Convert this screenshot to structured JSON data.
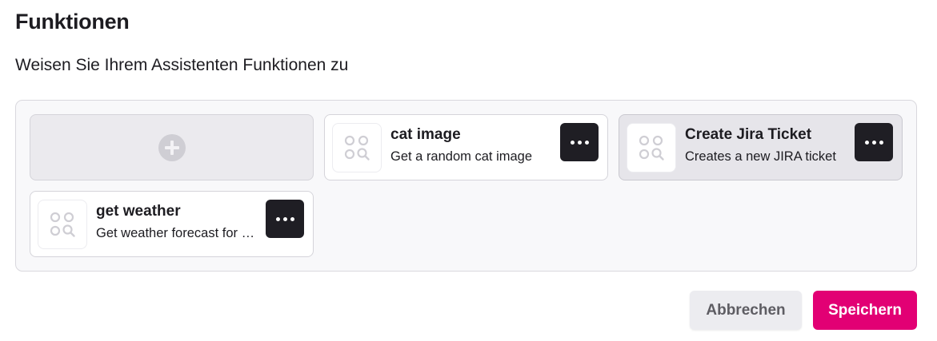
{
  "section": {
    "title": "Funktionen",
    "subtitle": "Weisen Sie Ihrem Assistenten Funktionen zu"
  },
  "add_tile": {
    "icon": "plus-circle-icon"
  },
  "functions": [
    {
      "name": "cat image",
      "description": "Get a random cat image",
      "icon": "function-search-icon",
      "menu_icon": "more-horizontal-icon",
      "selected": false
    },
    {
      "name": "Create Jira Ticket",
      "description": "Creates a new JIRA ticket",
      "icon": "function-search-icon",
      "menu_icon": "more-horizontal-icon",
      "selected": true
    },
    {
      "name": "get weather",
      "description": "Get weather forecast for a location",
      "icon": "function-search-icon",
      "menu_icon": "more-horizontal-icon",
      "selected": false
    }
  ],
  "footer": {
    "cancel_label": "Abbrechen",
    "save_label": "Speichern"
  },
  "colors": {
    "accent": "#e20074",
    "menu_button": "#1f1e24",
    "selected_card": "#e6e5ea",
    "panel_background": "#f8f8fa"
  }
}
